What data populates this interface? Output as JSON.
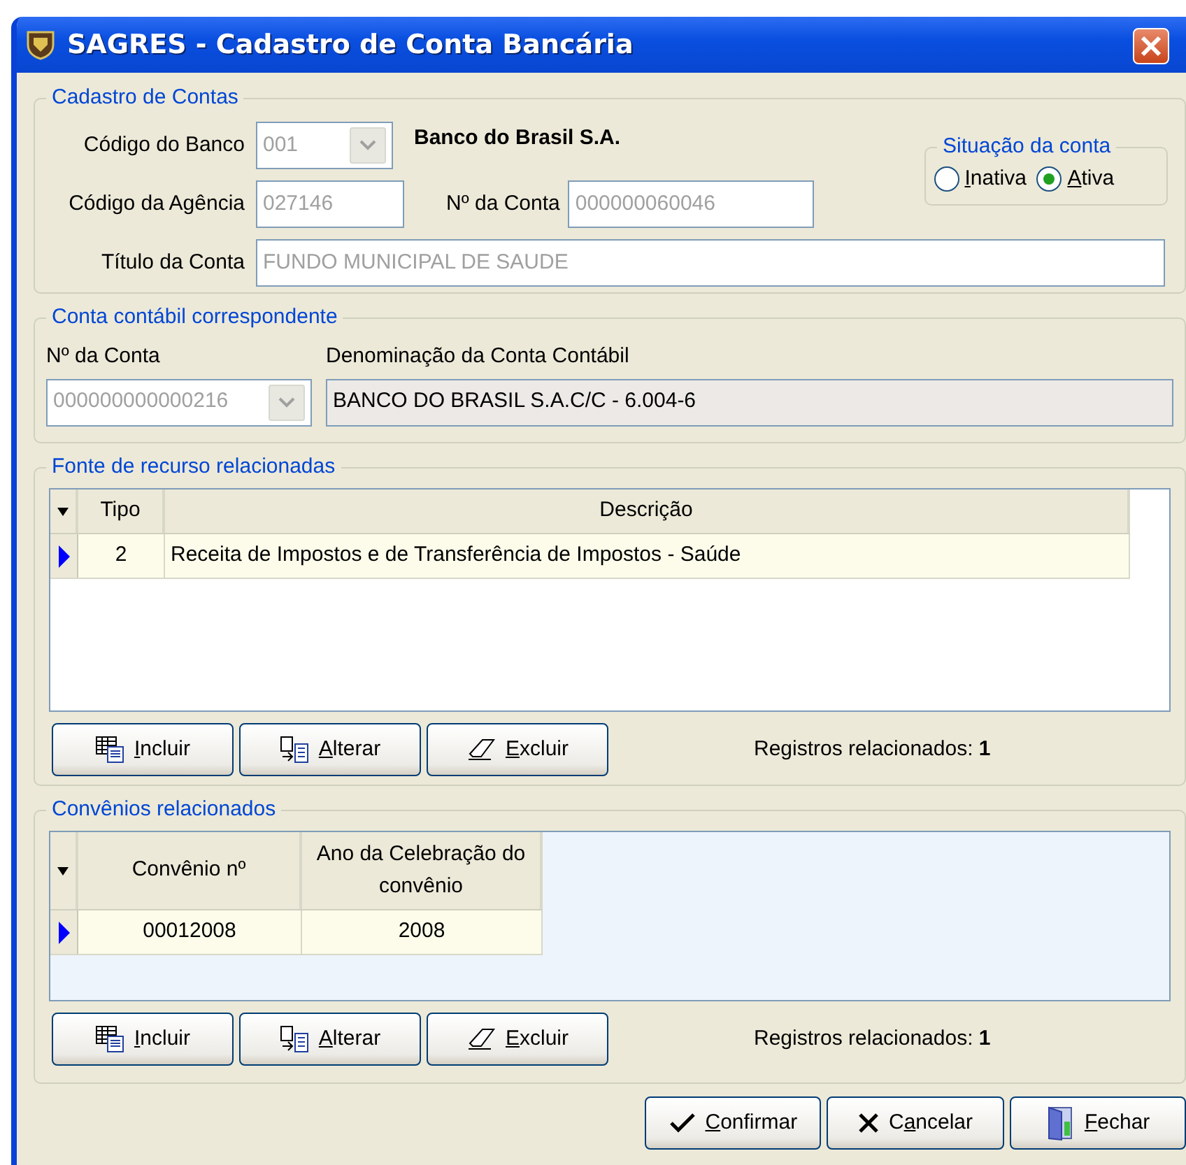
{
  "window": {
    "title": "SAGRES - Cadastro de Conta Bancária"
  },
  "cadastro": {
    "legend": "Cadastro de Contas",
    "banco_label": "Código do Banco",
    "banco_code": "001",
    "banco_name": "Banco do Brasil S.A.",
    "agencia_label": "Código da Agência",
    "agencia": "027146",
    "conta_label": "Nº da Conta",
    "conta": "000000060046",
    "titulo_label": "Título da Conta",
    "titulo": "FUNDO MUNICIPAL DE SAUDE",
    "situacao": {
      "legend": "Situação da conta",
      "options": [
        {
          "key": "I",
          "rest": "nativa",
          "selected": false
        },
        {
          "key": "A",
          "rest": "tiva",
          "selected": true
        }
      ]
    }
  },
  "contabil": {
    "legend": "Conta contábil correspondente",
    "conta_label": "Nº da Conta",
    "conta": "000000000000216",
    "denominacao_label": "Denominação da Conta Contábil",
    "denominacao": "BANCO DO BRASIL S.A.C/C - 6.004-6"
  },
  "fontes": {
    "legend": "Fonte de recurso relacionadas",
    "columns": [
      "Tipo",
      "Descrição"
    ],
    "rows": [
      {
        "cells": [
          "2",
          "Receita de Impostos e de Transferência de Impostos - Saúde"
        ],
        "selected": true
      }
    ],
    "buttons": [
      {
        "kind": "include",
        "key": "I",
        "rest": "ncluir"
      },
      {
        "kind": "edit",
        "key": "A",
        "rest": "lterar"
      },
      {
        "kind": "erase",
        "key": "E",
        "rest": "xcluir"
      }
    ],
    "count_label": "Registros relacionados:",
    "count": "1"
  },
  "convenios": {
    "legend": "Convênios relacionados",
    "columns": [
      "Convênio nº",
      "Ano da Celebração do convênio"
    ],
    "rows": [
      {
        "cells": [
          "00012008",
          "2008"
        ],
        "selected": true
      }
    ],
    "buttons": [
      {
        "kind": "include",
        "key": "I",
        "rest": "ncluir"
      },
      {
        "kind": "edit",
        "key": "A",
        "rest": "lterar"
      },
      {
        "kind": "erase",
        "key": "E",
        "rest": "xcluir"
      }
    ],
    "count_label": "Registros relacionados:",
    "count": "1"
  },
  "footer_buttons": [
    {
      "kind": "confirm",
      "key": "C",
      "rest": "onfirmar"
    },
    {
      "kind": "cancel",
      "lead": "C",
      "key": "a",
      "rest": "ncelar"
    },
    {
      "kind": "close",
      "key": "F",
      "rest": "echar"
    }
  ]
}
